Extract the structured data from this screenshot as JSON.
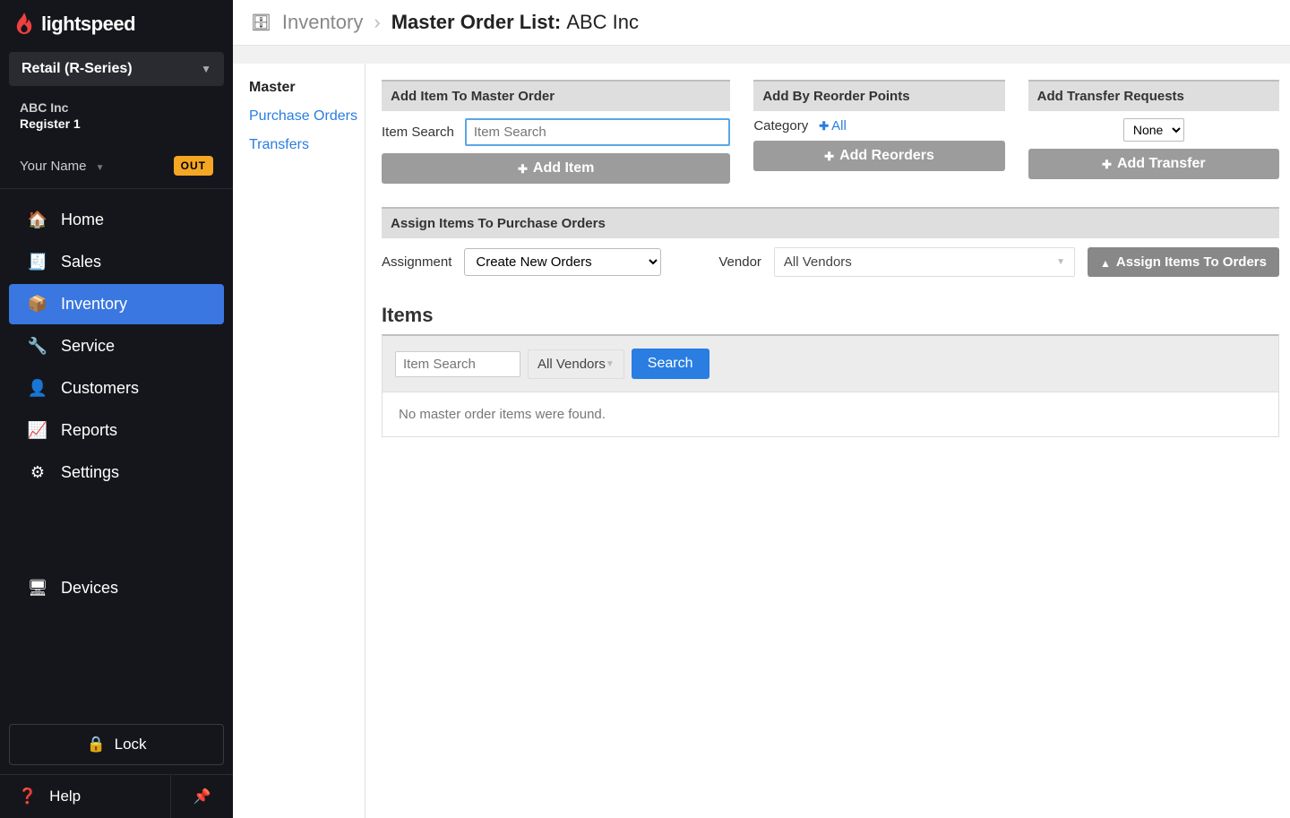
{
  "brand": "lightspeed",
  "product_selector": "Retail (R-Series)",
  "company": {
    "name": "ABC Inc",
    "register": "Register 1"
  },
  "user": {
    "name": "Your Name",
    "status": "OUT"
  },
  "nav": {
    "home": "Home",
    "sales": "Sales",
    "inventory": "Inventory",
    "service": "Service",
    "customers": "Customers",
    "reports": "Reports",
    "settings": "Settings",
    "devices": "Devices"
  },
  "lock_label": "Lock",
  "help_label": "Help",
  "breadcrumb": {
    "root": "Inventory",
    "leaf_label": "Master Order List:",
    "leaf_context": "ABC Inc"
  },
  "subnav": {
    "master": "Master",
    "purchase_orders": "Purchase Orders",
    "transfers": "Transfers"
  },
  "panels": {
    "add_item": {
      "title": "Add Item To Master Order",
      "label": "Item Search",
      "placeholder": "Item Search",
      "button": "Add Item"
    },
    "add_reorder": {
      "title": "Add By Reorder Points",
      "label": "Category",
      "all_link": "All",
      "button": "Add Reorders"
    },
    "add_transfer": {
      "title": "Add Transfer Requests",
      "select_value": "None",
      "button": "Add Transfer"
    },
    "assign": {
      "title": "Assign Items To Purchase Orders",
      "assignment_label": "Assignment",
      "assignment_option": "Create New Orders",
      "vendor_label": "Vendor",
      "vendor_value": "All Vendors",
      "button": "Assign Items To Orders"
    }
  },
  "items": {
    "header": "Items",
    "search_placeholder": "Item Search",
    "vendor_value": "All Vendors",
    "search_button": "Search",
    "empty_message": "No master order items were found."
  }
}
